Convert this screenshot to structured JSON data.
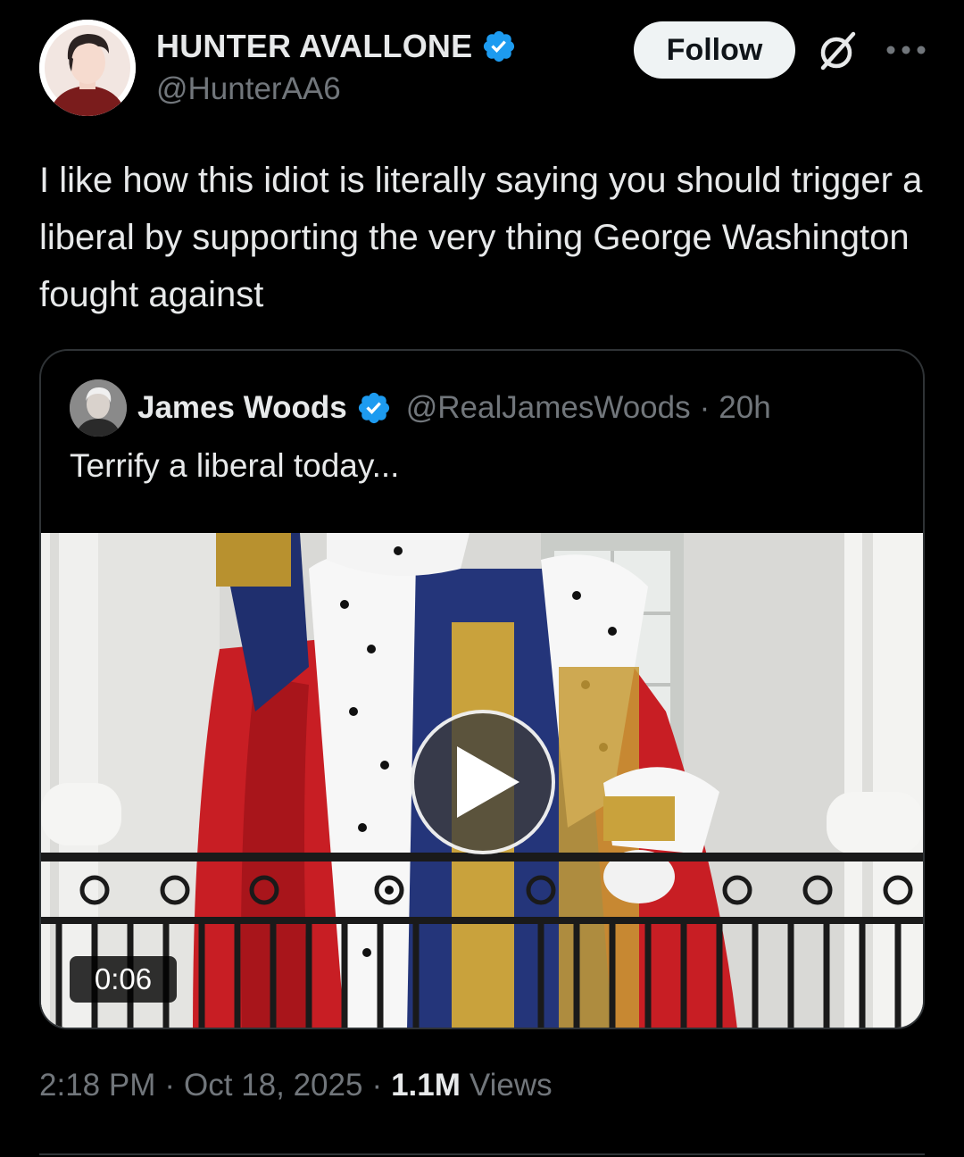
{
  "author": {
    "display_name": "HUNTER AVALLONE",
    "handle": "@HunterAA6",
    "verified": true,
    "avatar_icon": "cartoon-avatar"
  },
  "actions": {
    "follow_label": "Follow",
    "grok_icon": "grok-icon",
    "more_icon": "more-options-icon"
  },
  "tweet": {
    "text": "I like how this idiot is literally saying you should trigger a liberal by supporting the very thing George Washington fought against"
  },
  "quoted_tweet": {
    "display_name": "James Woods",
    "handle": "@RealJamesWoods",
    "separator": "·",
    "time": "20h",
    "verified": true,
    "text": "Terrify a liberal today...",
    "media": {
      "type": "video",
      "duration": "0:06",
      "play_icon": "play-icon"
    }
  },
  "meta": {
    "time": "2:18 PM",
    "date": "Oct 18, 2025",
    "separator": "·",
    "views_count": "1.1M",
    "views_label": "Views"
  },
  "colors": {
    "background": "#000000",
    "text_primary": "#e7e9ea",
    "text_secondary": "#71767b",
    "verified_blue": "#1d9bf0",
    "border": "#2f3336"
  }
}
